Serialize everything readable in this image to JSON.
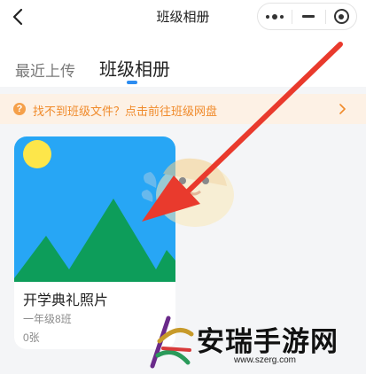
{
  "navbar": {
    "title": "班级相册",
    "back_icon": "chevron-left-icon",
    "more_icon": "more-dots-icon",
    "minimize_icon": "minus-icon",
    "close_icon": "target-circle-icon"
  },
  "tabs": [
    {
      "label": "最近上传",
      "active": false
    },
    {
      "label": "班级相册",
      "active": true
    }
  ],
  "notice": {
    "icon": "question-circle-icon",
    "icon_glyph": "?",
    "text": "找不到班级文件？点击前往班级网盘",
    "arrow_icon": "chevron-right-icon",
    "color": "#f08a2a",
    "background": "#fdf1e5"
  },
  "albums": [
    {
      "title": "开学典礼照片",
      "class_name": "一年级8班",
      "count": "0张",
      "cover_icon": "image-placeholder-icon"
    }
  ],
  "overlay": {
    "arrow_color": "#e93a2d",
    "mascot_icon": "mascot-bird-icon"
  },
  "watermark": {
    "logo_icon": "anrui-logo-icon",
    "title": "安瑞手游网",
    "url": "www.szerg.com"
  },
  "colors": {
    "accent": "#2c8cf0",
    "cover_sky": "#27a6f5",
    "cover_sun": "#fde64a",
    "cover_mountain": "#0d9d5a"
  }
}
